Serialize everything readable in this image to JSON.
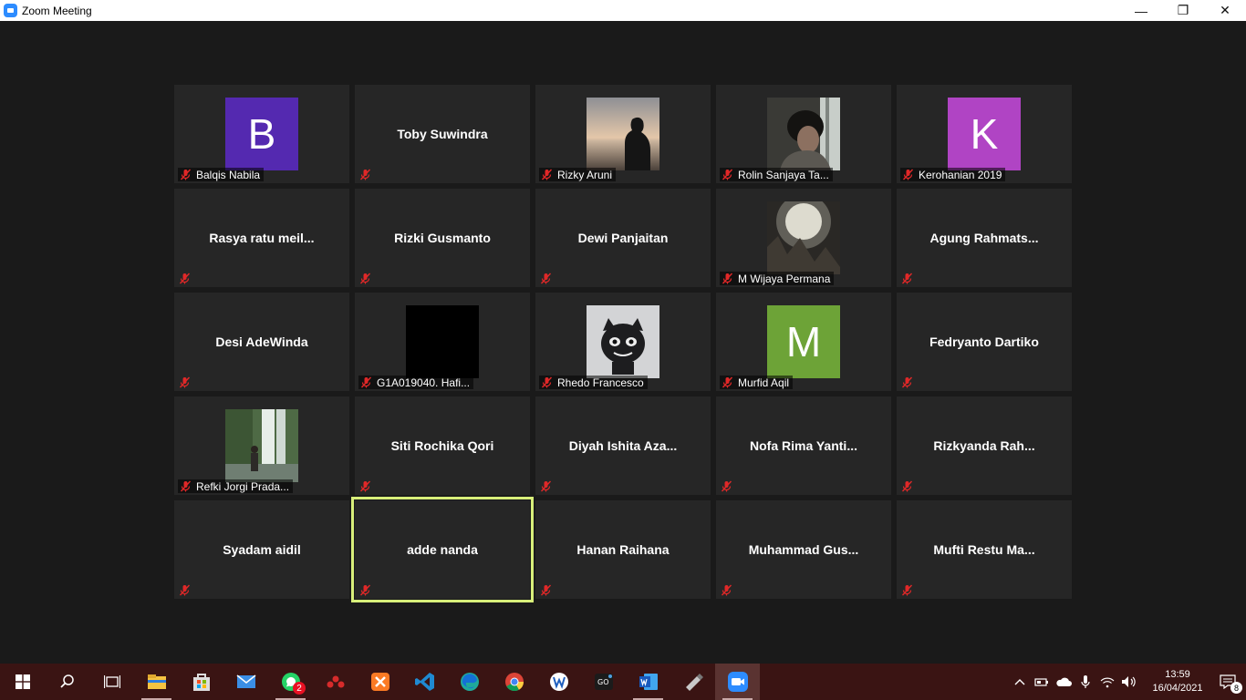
{
  "window": {
    "title": "Zoom Meeting",
    "minimize": "—",
    "restore": "❐",
    "close": "✕"
  },
  "participants": [
    {
      "name": "Balqis Nabila",
      "type": "avatar",
      "initial": "B",
      "color": "#5429b0"
    },
    {
      "name": "Toby Suwindra",
      "type": "name"
    },
    {
      "name": "Rizky Aruni",
      "type": "photo",
      "photo": "sunset"
    },
    {
      "name": "Rolin Sanjaya Ta...",
      "type": "photo",
      "photo": "window"
    },
    {
      "name": "Kerohanian 2019",
      "type": "avatar",
      "initial": "K",
      "color": "#b044c4"
    },
    {
      "name": "Rasya ratu meil...",
      "type": "name"
    },
    {
      "name": "Rizki Gusmanto",
      "type": "name"
    },
    {
      "name": "Dewi Panjaitan",
      "type": "name"
    },
    {
      "name": "M Wijaya Permana",
      "type": "photo",
      "photo": "light"
    },
    {
      "name": "Agung Rahmats...",
      "type": "name"
    },
    {
      "name": "Desi AdeWinda",
      "type": "name"
    },
    {
      "name": "G1A019040. Hafi...",
      "type": "photo",
      "photo": "black"
    },
    {
      "name": "Rhedo Francesco",
      "type": "photo",
      "photo": "toy"
    },
    {
      "name": "Murfid Aqil",
      "type": "avatar",
      "initial": "M",
      "color": "#6da337"
    },
    {
      "name": "Fedryanto Dartiko",
      "type": "name"
    },
    {
      "name": "Refki Jorgi Prada...",
      "type": "photo",
      "photo": "waterfall"
    },
    {
      "name": "Siti Rochika Qori",
      "type": "name"
    },
    {
      "name": "Diyah Ishita Aza...",
      "type": "name"
    },
    {
      "name": "Nofa Rima Yanti...",
      "type": "name"
    },
    {
      "name": "Rizkyanda Rah...",
      "type": "name"
    },
    {
      "name": "Syadam aidil",
      "type": "name"
    },
    {
      "name": "adde nanda",
      "type": "name",
      "active": true
    },
    {
      "name": "Hanan Raihana",
      "type": "name"
    },
    {
      "name": "Muhammad Gus...",
      "type": "name"
    },
    {
      "name": "Mufti Restu Ma...",
      "type": "name"
    }
  ],
  "taskbar": {
    "apps": [
      {
        "name": "file-explorer",
        "running": true
      },
      {
        "name": "microsoft-store",
        "running": false
      },
      {
        "name": "mail",
        "running": false
      },
      {
        "name": "whatsapp",
        "running": true,
        "badge": "2"
      },
      {
        "name": "mendeley",
        "running": false
      },
      {
        "name": "xampp",
        "running": false
      },
      {
        "name": "vscode",
        "running": false
      },
      {
        "name": "edge",
        "running": false
      },
      {
        "name": "chrome",
        "running": false
      },
      {
        "name": "wps-writer",
        "running": false
      },
      {
        "name": "golang",
        "running": false
      },
      {
        "name": "word",
        "running": true
      },
      {
        "name": "usb-tool",
        "running": false
      },
      {
        "name": "zoom",
        "running": true,
        "active": true
      }
    ],
    "clock": {
      "time": "13:59",
      "date": "16/04/2021"
    },
    "notification_count": "8"
  }
}
